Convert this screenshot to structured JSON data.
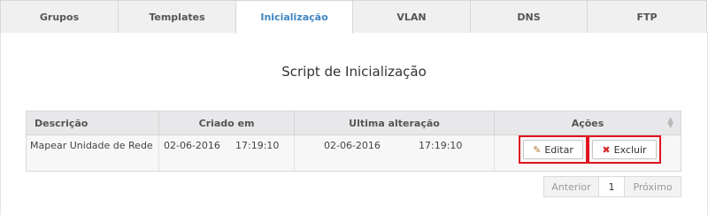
{
  "tabs": [
    {
      "label": "Grupos"
    },
    {
      "label": "Templates"
    },
    {
      "label": "Inicialização"
    },
    {
      "label": "VLAN"
    },
    {
      "label": "DNS"
    },
    {
      "label": "FTP"
    }
  ],
  "active_tab": "Inicialização",
  "page_title": "Script de Inicialização",
  "table": {
    "columns": [
      "Descrição",
      "Criado em",
      "Ultima alteração",
      "Ações"
    ],
    "rows": [
      {
        "descricao": "Mapear Unidade de Rede",
        "criado_data": "02-06-2016",
        "criado_hora": "17:19:10",
        "alterado_data": "02-06-2016",
        "alterado_hora": "17:19:10"
      }
    ]
  },
  "actions": {
    "edit_label": "Editar",
    "delete_label": "Excluir"
  },
  "pagination": {
    "previous_label": "Anterior",
    "current_page": "1",
    "next_label": "Próximo"
  },
  "icons": {
    "edit": "pencil-icon",
    "delete": "x-icon",
    "sort": "sort-icon"
  },
  "colors": {
    "active_tab_text": "#3f86c4",
    "highlight_border": "#e0141e",
    "delete_icon": "#d9262b"
  }
}
